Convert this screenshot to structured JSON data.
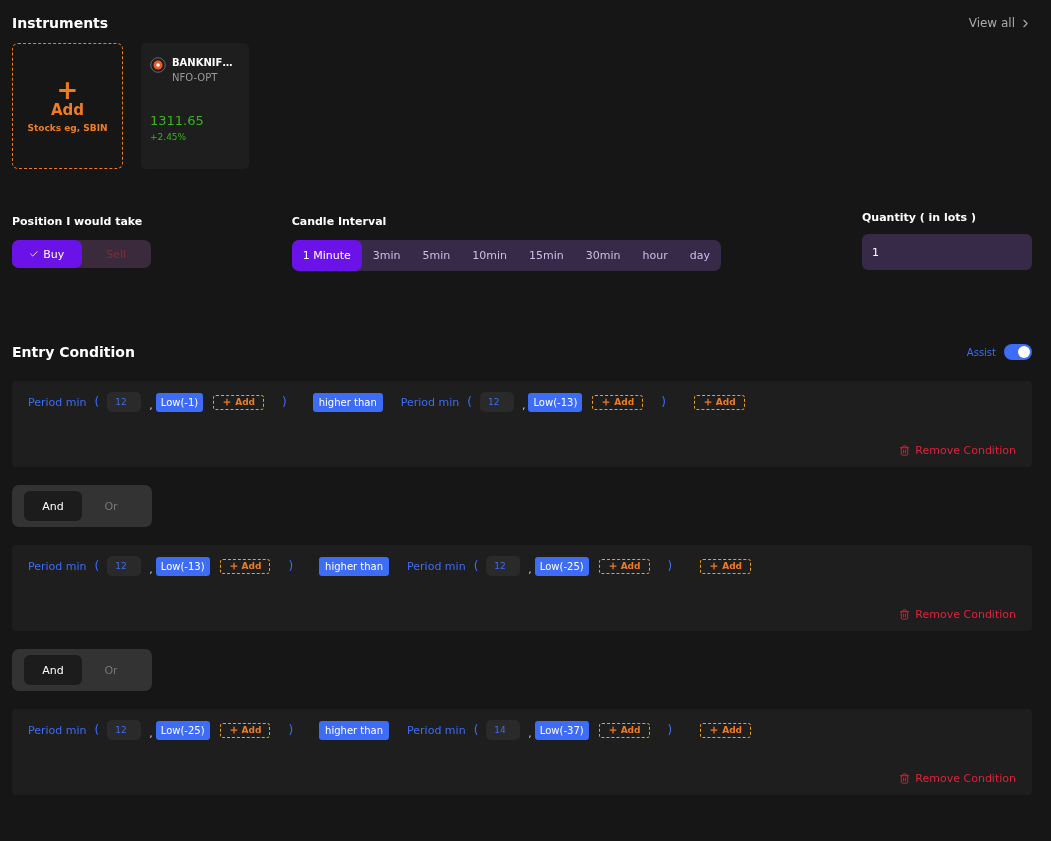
{
  "instruments": {
    "title": "Instruments",
    "view_all": "View all",
    "add_card": {
      "icon": "+",
      "label": "Add",
      "hint": "Stocks eg, SBIN"
    },
    "items": [
      {
        "name": "BANKNIF…",
        "segment": "NFO-OPT",
        "price": "1311.65",
        "change": "+2.45%"
      }
    ]
  },
  "position": {
    "label": "Position I would take",
    "options": [
      {
        "label": "Buy",
        "selected": true
      },
      {
        "label": "Sell",
        "selected": false
      }
    ]
  },
  "candle_interval": {
    "label": "Candle Interval",
    "options": [
      {
        "label": "1 Minute",
        "selected": true
      },
      {
        "label": "3min",
        "selected": false
      },
      {
        "label": "5min",
        "selected": false
      },
      {
        "label": "10min",
        "selected": false
      },
      {
        "label": "15min",
        "selected": false
      },
      {
        "label": "30min",
        "selected": false
      },
      {
        "label": "hour",
        "selected": false
      },
      {
        "label": "day",
        "selected": false
      }
    ]
  },
  "quantity": {
    "label": "Quantity ( in lots )",
    "value": "1"
  },
  "entry_condition": {
    "title": "Entry Condition",
    "assist": {
      "label": "Assist",
      "on": true
    },
    "blocks": [
      {
        "kind": "condition",
        "left": {
          "func": "Period min",
          "open": "(",
          "param": "12",
          "sep": ",",
          "chip": "Low(-1)",
          "add": "Add",
          "close": ")"
        },
        "operator": "higher than",
        "right": {
          "func": "Period min",
          "open": "(",
          "param": "12",
          "sep": ",",
          "chip": "Low(-13)",
          "add": "Add",
          "close": ")"
        },
        "add": "Add",
        "remove": "Remove Condition"
      },
      {
        "kind": "logic",
        "options": [
          {
            "label": "And",
            "selected": true
          },
          {
            "label": "Or",
            "selected": false
          }
        ]
      },
      {
        "kind": "condition",
        "left": {
          "func": "Period min",
          "open": "(",
          "param": "12",
          "sep": ",",
          "chip": "Low(-13)",
          "add": "Add",
          "close": ")"
        },
        "operator": "higher than",
        "right": {
          "func": "Period min",
          "open": "(",
          "param": "12",
          "sep": ",",
          "chip": "Low(-25)",
          "add": "Add",
          "close": ")"
        },
        "add": "Add",
        "remove": "Remove Condition"
      },
      {
        "kind": "logic",
        "options": [
          {
            "label": "And",
            "selected": true
          },
          {
            "label": "Or",
            "selected": false
          }
        ]
      },
      {
        "kind": "condition",
        "left": {
          "func": "Period min",
          "open": "(",
          "param": "12",
          "sep": ",",
          "chip": "Low(-25)",
          "add": "Add",
          "close": ")"
        },
        "operator": "higher than",
        "right": {
          "func": "Period min",
          "open": "(",
          "param": "14",
          "sep": ",",
          "chip": "Low(-37)",
          "add": "Add",
          "close": ")"
        },
        "add": "Add",
        "remove": "Remove Condition"
      }
    ]
  }
}
